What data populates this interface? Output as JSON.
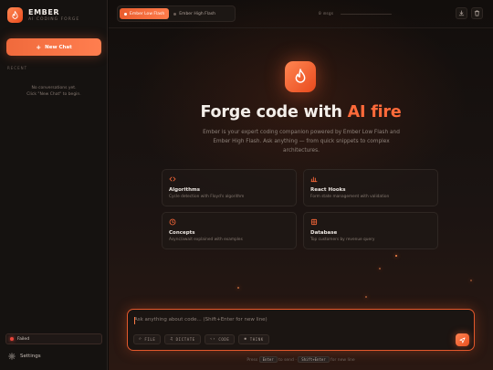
{
  "brand": {
    "name": "EMBER",
    "subtitle": "AI CODING FORGE"
  },
  "sidebar": {
    "new_chat_label": "New Chat",
    "recent_label": "RECENT",
    "empty_line1": "No conversations yet.",
    "empty_line2": "Click \"New Chat\" to begin.",
    "status_label": "Failed",
    "status_color": "#e8453a",
    "settings_label": "Settings"
  },
  "topbar": {
    "models": [
      {
        "label": "Ember Low Flash",
        "active": true
      },
      {
        "label": "Ember High Flash",
        "active": false
      }
    ],
    "msg_count": "0 msgs",
    "actions": [
      "download-icon",
      "trash-icon"
    ]
  },
  "hero": {
    "title_part1": "Forge code with ",
    "title_accent": "AI fire",
    "tagline": "Ember is your expert coding companion powered by Ember Low Flash and Ember High Flash. Ask anything — from quick snippets to complex architectures."
  },
  "cards": [
    {
      "icon": "code-icon",
      "title": "Algorithms",
      "sub": "Cycle detection with Floyd's algorithm"
    },
    {
      "icon": "bar-chart-icon",
      "title": "React Hooks",
      "sub": "Form state management with validation"
    },
    {
      "icon": "clock-icon",
      "title": "Concepts",
      "sub": "Async/await explained with examples"
    },
    {
      "icon": "database-icon",
      "title": "Database",
      "sub": "Top customers by revenue query"
    }
  ],
  "composer": {
    "placeholder": "Ask anything about code... (Shift+Enter for new line)",
    "chips": [
      {
        "icon": "paperclip-icon",
        "label": "FILE"
      },
      {
        "icon": "mic-icon",
        "label": "DICTATE"
      },
      {
        "icon": "code-icon",
        "label": "CODE"
      },
      {
        "icon": "brain-icon",
        "label": "THINK"
      }
    ],
    "hint_press": "Press",
    "hint_key1": "Enter",
    "hint_mid": "to send ·",
    "hint_key2": "Shift+Enter",
    "hint_end": "for new line"
  },
  "colors": {
    "accent": "#ff6a3a",
    "background": "#0d0b0a"
  }
}
